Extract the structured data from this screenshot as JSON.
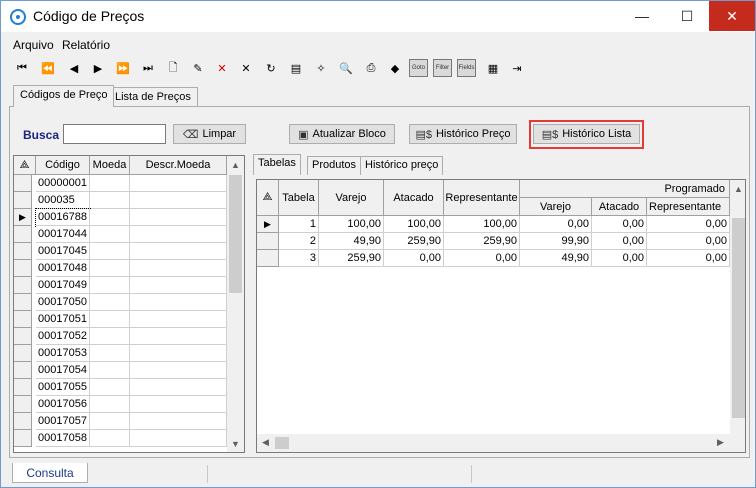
{
  "window": {
    "title": "Código de Preços",
    "minimize_glyph": "—",
    "maximize_glyph": "☐",
    "close_glyph": "✕"
  },
  "menu": {
    "arquivo": "Arquivo",
    "relatorio": "Relatório"
  },
  "toolbar": {
    "icons": [
      "first-icon",
      "prev-page-icon",
      "prev-icon",
      "next-icon",
      "next-page-icon",
      "last-icon",
      "new-document-icon",
      "edit-icon",
      "delete-icon",
      "cancel-icon",
      "refresh-icon",
      "properties-icon",
      "magic-wand-icon",
      "preview-icon",
      "print-icon",
      "export-icon",
      "goto-icon",
      "filter-icon",
      "fields-icon",
      "report-icon",
      "exit-icon"
    ],
    "goto_label": "Goto",
    "filter_label": "Filter",
    "fields_label": "Fields"
  },
  "outer_tabs": [
    "Códigos de Preço",
    "Lista de Preços"
  ],
  "search": {
    "label": "Busca",
    "value": "",
    "clear_button": "Limpar",
    "update_button": "Atualizar Bloco",
    "price_history_button": "Histórico Preço",
    "list_history_button": "Histórico Lista"
  },
  "codes_grid": {
    "columns": [
      "Código",
      "Moeda",
      "Descr.Moeda"
    ],
    "rows": [
      "00000001",
      "000035",
      "00016788",
      "00017044",
      "00017045",
      "00017048",
      "00017049",
      "00017050",
      "00017051",
      "00017052",
      "00017053",
      "00017054",
      "00017055",
      "00017056",
      "00017057",
      "00017058"
    ],
    "selected_index": 2
  },
  "inner_tabs": [
    "Tabelas",
    "Produtos",
    "Histórico preço"
  ],
  "prices_grid": {
    "columns": [
      "Tabela",
      "Varejo",
      "Atacado",
      "Representante"
    ],
    "group_header": "Programado",
    "sub_columns": [
      "Varejo",
      "Atacado",
      "Representante"
    ],
    "rows": [
      [
        "1",
        "100,00",
        "100,00",
        "100,00",
        "0,00",
        "0,00",
        "0,00"
      ],
      [
        "2",
        "49,90",
        "259,90",
        "259,90",
        "99,90",
        "0,00",
        "0,00"
      ],
      [
        "3",
        "259,90",
        "0,00",
        "0,00",
        "49,90",
        "0,00",
        "0,00"
      ]
    ]
  },
  "status": {
    "tab": "Consulta"
  }
}
